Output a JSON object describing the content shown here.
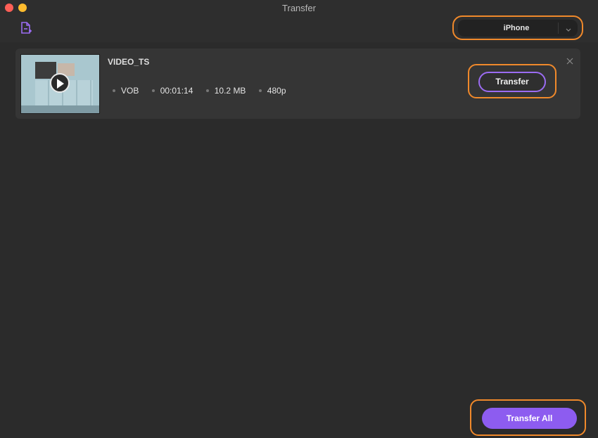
{
  "window": {
    "title": "Transfer"
  },
  "toolbar": {
    "add_file_icon": "add-file-icon",
    "device": {
      "selected": "iPhone",
      "icon": "chevron-down-icon"
    }
  },
  "item": {
    "name": "VIDEO_TS",
    "format": "VOB",
    "duration": "00:01:14",
    "size": "10.2 MB",
    "resolution": "480p",
    "transfer_label": "Transfer"
  },
  "footer": {
    "transfer_all_label": "Transfer All"
  },
  "colors": {
    "accent": "#8d5cf0",
    "highlight": "#f0892b",
    "background": "#2b2b2b"
  }
}
